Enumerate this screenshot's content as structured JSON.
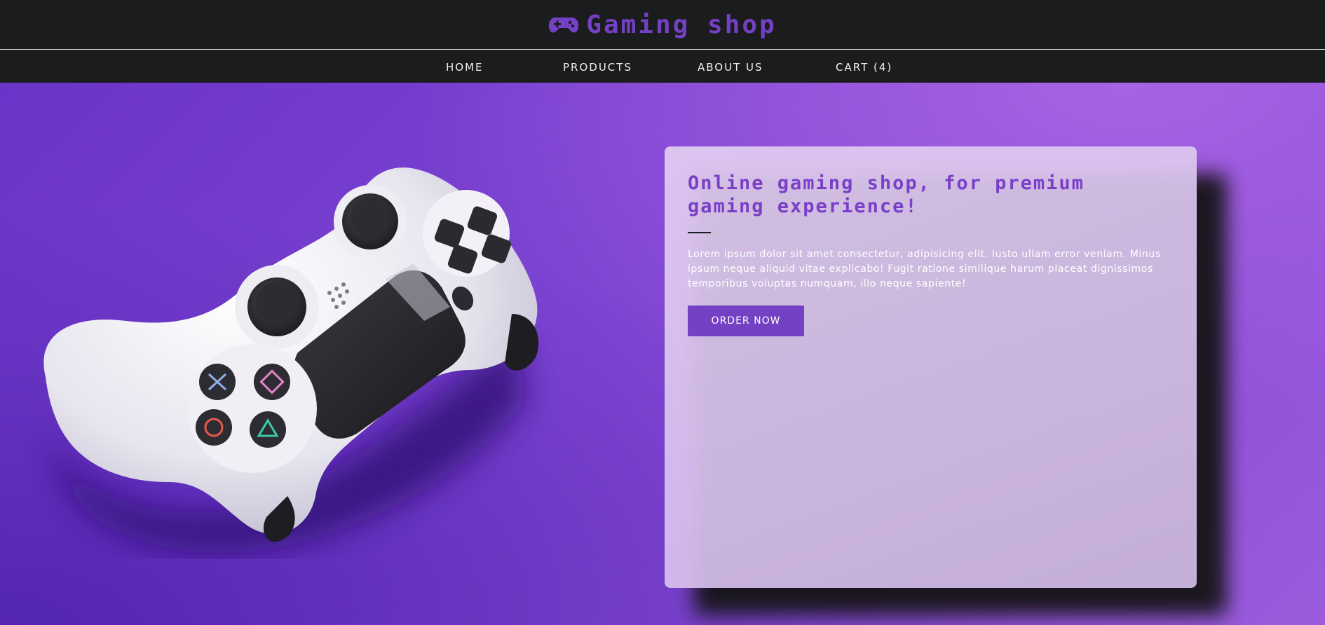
{
  "header": {
    "logo_icon": "gamepad-icon",
    "title": "Gaming shop"
  },
  "nav": {
    "items": [
      {
        "label": "HOME"
      },
      {
        "label": "PRODUCTS"
      },
      {
        "label": "ABOUT US"
      },
      {
        "label": "CART (4)"
      }
    ]
  },
  "hero": {
    "image": "game-controller-photo",
    "title": "Online gaming shop, for premium gaming experience!",
    "description": "Lorem ipsum dolor sit amet consectetur, adipisicing elit. Iusto ullam error veniam. Minus ipsum neque aliquid vitae explicabo! Fugit ratione similique harum placeat dignissimos temporibus voluptas numquam, illo neque sapiente!",
    "cta_label": "ORDER NOW"
  },
  "colors": {
    "accent": "#7440c4",
    "header_bg": "#1b1c1e",
    "hero_bg": "#7e45d2",
    "card_bg": "#dcc6f0"
  }
}
